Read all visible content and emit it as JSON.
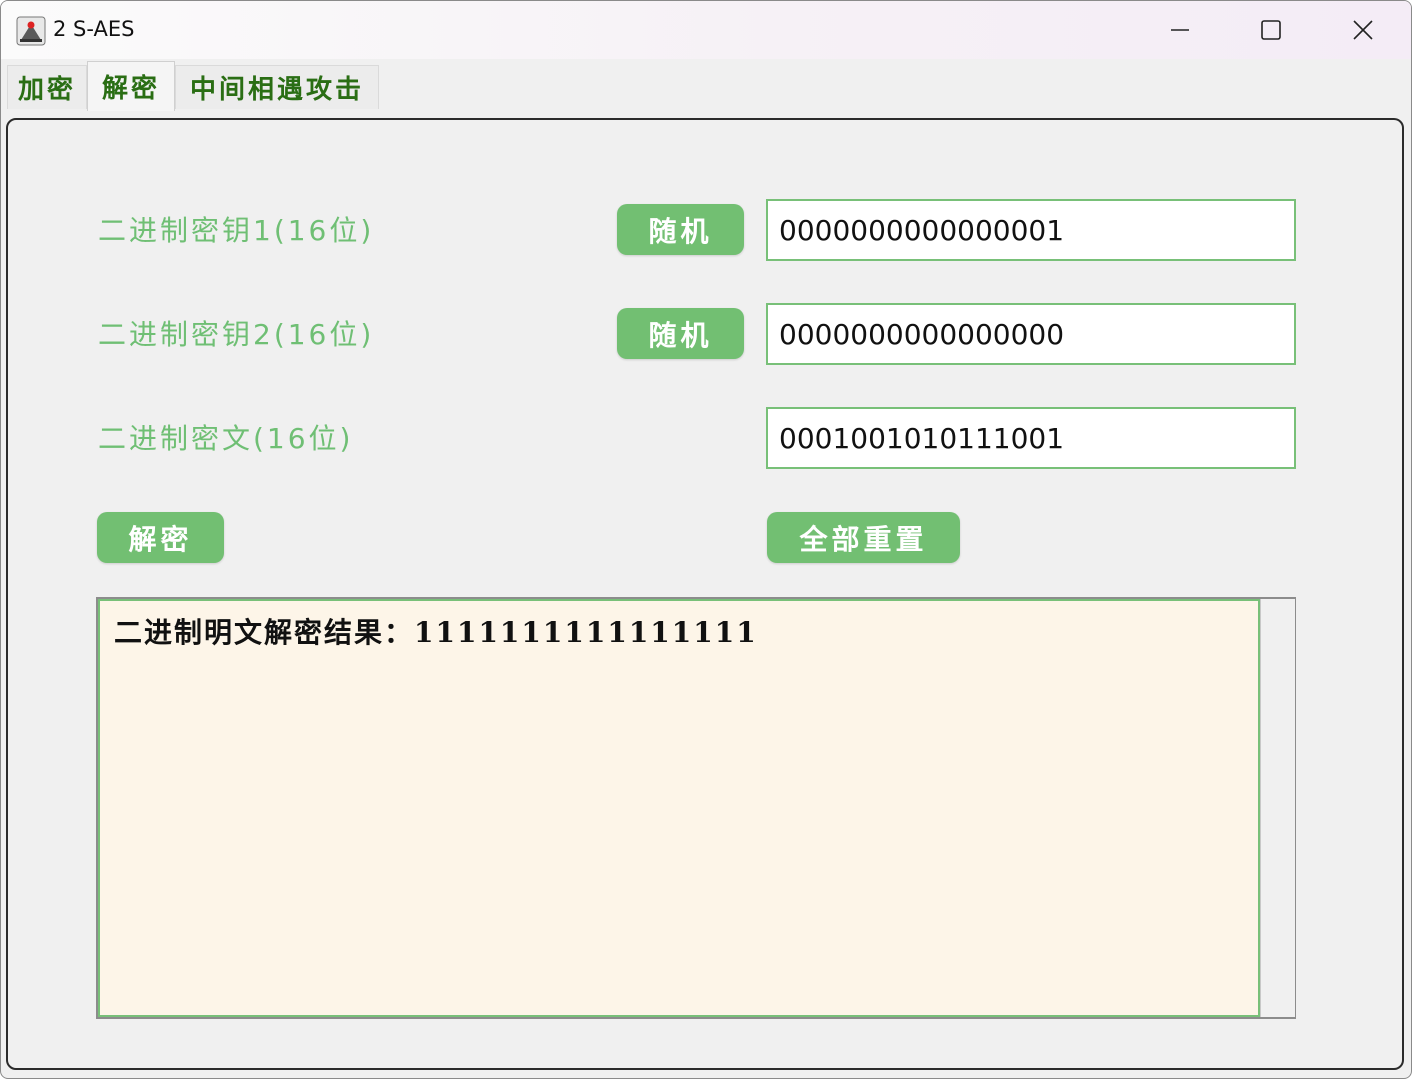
{
  "window": {
    "title": "2 S-AES"
  },
  "tabs": [
    {
      "label": "加密",
      "active": false
    },
    {
      "label": "解密",
      "active": true
    },
    {
      "label": "中间相遇攻击",
      "active": false
    }
  ],
  "form": {
    "key1": {
      "label": "二进制密钥1(16位)",
      "random_label": "随机",
      "value": "0000000000000001"
    },
    "key2": {
      "label": "二进制密钥2(16位)",
      "random_label": "随机",
      "value": "0000000000000000"
    },
    "ciphertext": {
      "label": "二进制密文(16位)",
      "value": "0001001010111001"
    },
    "decrypt_label": "解密",
    "reset_label": "全部重置"
  },
  "output": {
    "text": "二进制明文解密结果：1111111111111111"
  },
  "colors": {
    "accent_green": "#72bf72",
    "label_green": "#6fbf74",
    "tab_text": "#2a6e14",
    "output_background": "#fdf5e8"
  }
}
